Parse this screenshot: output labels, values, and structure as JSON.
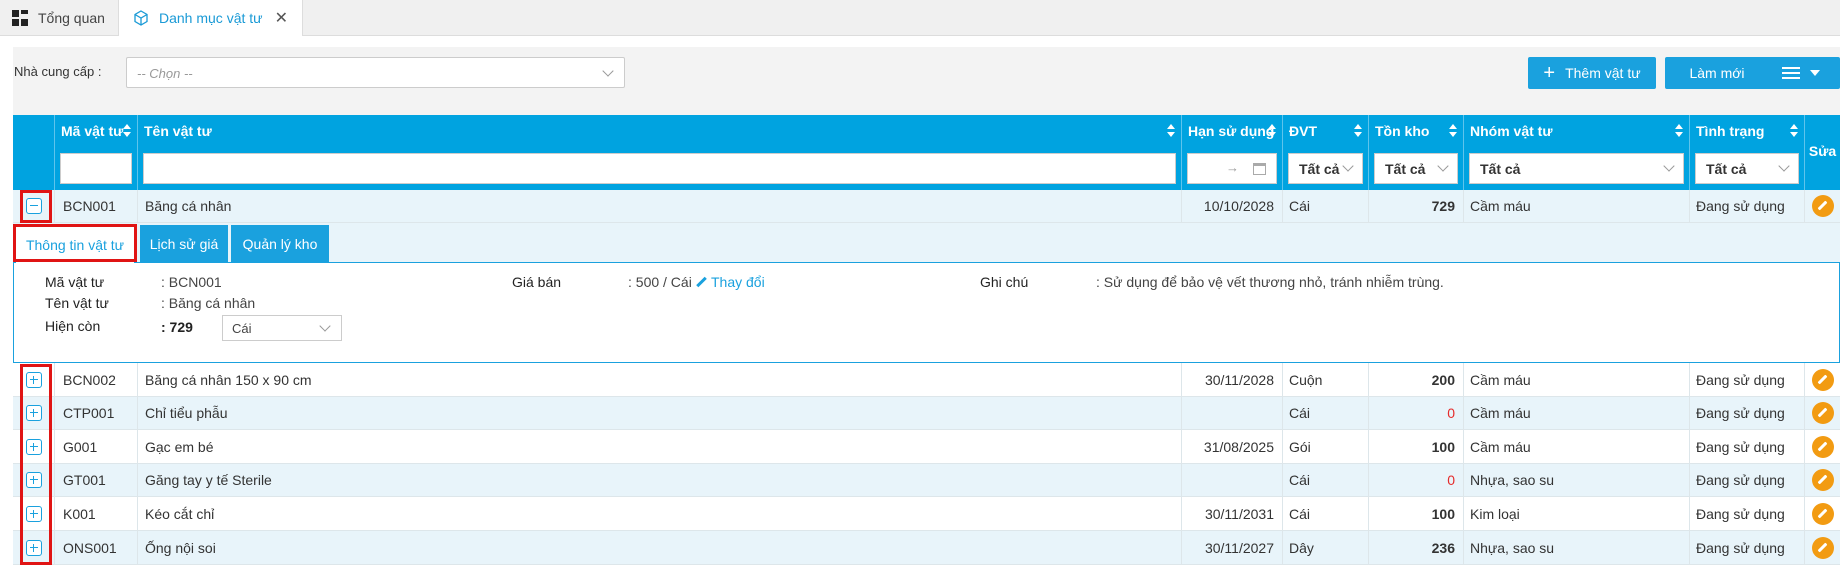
{
  "tabs": {
    "home": "Tổng quan",
    "active": "Danh mục vật tư"
  },
  "filter": {
    "supplier_label": "Nhà cung cấp :",
    "supplier_placeholder": "-- Chọn --"
  },
  "toolbar": {
    "add_label": "Thêm vật tư",
    "refresh_label": "Làm mới"
  },
  "columns": {
    "code": "Mã vật tư",
    "name": "Tên vật tư",
    "expiry": "Hạn sử dụng",
    "unit": "ĐVT",
    "stock": "Tồn kho",
    "group": "Nhóm vật tư",
    "status": "Tình trạng",
    "edit": "Sửa"
  },
  "column_filters": {
    "unit": "Tất cả",
    "stock": "Tất cả",
    "group": "Tất cả",
    "status": "Tất cả",
    "date_separator": "→"
  },
  "rows": [
    {
      "code": "BCN001",
      "name": "Băng cá nhân",
      "expiry": "10/10/2028",
      "unit": "Cái",
      "stock": "729",
      "group": "Cầm máu",
      "status": "Đang sử dụng",
      "expanded": true
    },
    {
      "code": "BCN002",
      "name": "Băng cá nhân 150 x 90 cm",
      "expiry": "30/11/2028",
      "unit": "Cuộn",
      "stock": "200",
      "group": "Cầm máu",
      "status": "Đang sử dụng"
    },
    {
      "code": "CTP001",
      "name": "Chỉ tiểu phẫu",
      "expiry": "",
      "unit": "Cái",
      "stock": "0",
      "group": "Cầm máu",
      "status": "Đang sử dụng"
    },
    {
      "code": "G001",
      "name": "Gạc em bé",
      "expiry": "31/08/2025",
      "unit": "Gói",
      "stock": "100",
      "group": "Cầm máu",
      "status": "Đang sử dụng"
    },
    {
      "code": "GT001",
      "name": "Găng tay y tế Sterile",
      "expiry": "",
      "unit": "Cái",
      "stock": "0",
      "group": "Nhựa, sao su",
      "status": "Đang sử dụng"
    },
    {
      "code": "K001",
      "name": "Kéo cắt chỉ",
      "expiry": "30/11/2031",
      "unit": "Cái",
      "stock": "100",
      "group": "Kim loại",
      "status": "Đang sử dụng"
    },
    {
      "code": "ONS001",
      "name": "Ống nội soi",
      "expiry": "30/11/2027",
      "unit": "Dây",
      "stock": "236",
      "group": "Nhựa, sao su",
      "status": "Đang sử dụng"
    }
  ],
  "detail": {
    "tabs": [
      "Thông tin vật tư",
      "Lịch sử giá",
      "Quản lý kho"
    ],
    "code_label": "Mã vật tư",
    "code_value": ": BCN001",
    "name_label": "Tên vật tư",
    "name_value": ": Băng cá nhân",
    "stock_label": "Hiện còn",
    "stock_value": ": 729",
    "stock_unit": "Cái",
    "price_label": "Giá bán",
    "price_value": ": 500 / Cái",
    "change_link": "Thay đổi",
    "note_label": "Ghi chú",
    "note_value": ": Sử dụng để bảo vệ vết thương nhỏ, tránh nhiễm trùng."
  },
  "colors": {
    "accent": "#1aa1de",
    "header": "#00a3e0",
    "edit": "#f29b12",
    "zero_stock": "#e52b2b",
    "highlight": "#e01414"
  }
}
